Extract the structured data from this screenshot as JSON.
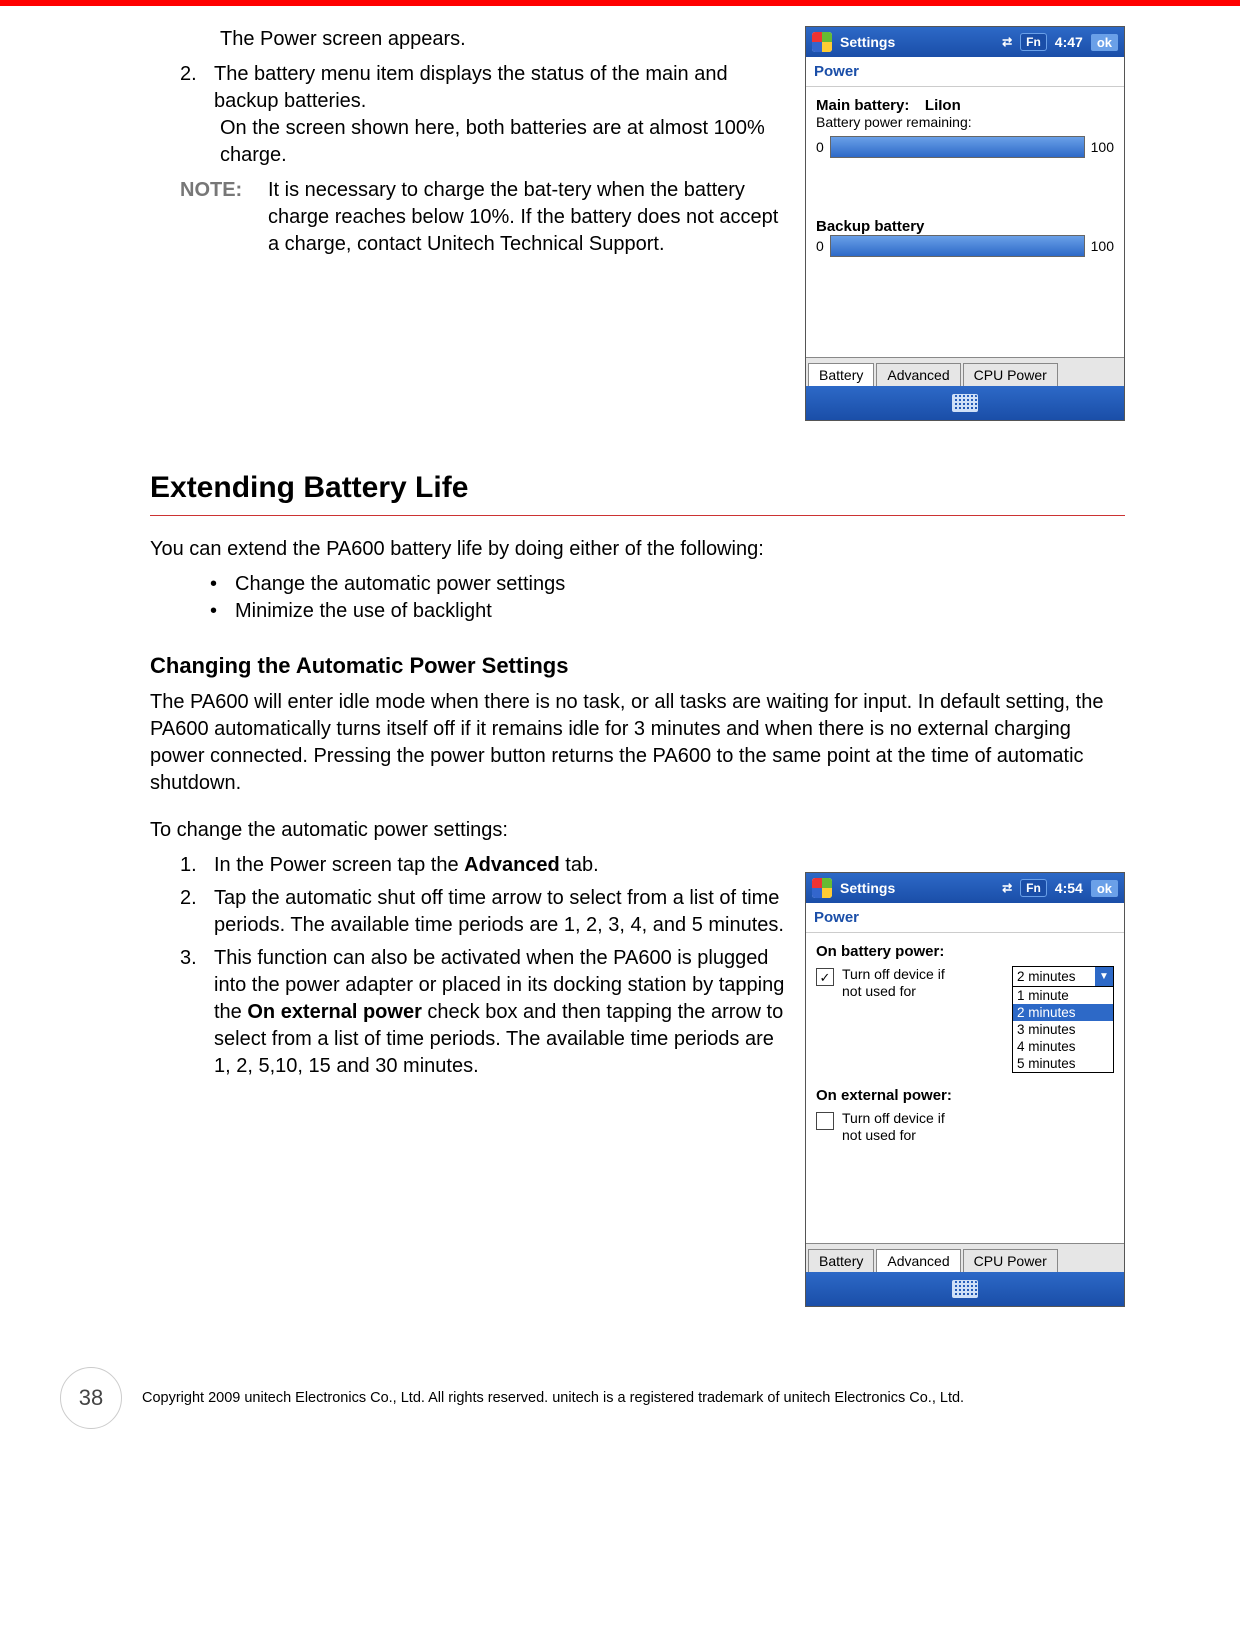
{
  "top": {
    "para1": "The Power screen appears.",
    "item2_num": "2.",
    "item2": "The battery menu item displays the status of the main and backup batteries.",
    "para2": "On the screen shown here, both batteries are at almost 100% charge.",
    "note_label": "NOTE:",
    "note_text": "It is necessary to charge the bat-tery when the battery charge reaches below 10%. If the battery does not accept a charge, contact Unitech Technical Support."
  },
  "device1": {
    "title": "Settings",
    "fn": "Fn",
    "time": "4:47",
    "ok": "ok",
    "sub": "Power",
    "main_label": "Main battery:",
    "main_type": "LiIon",
    "remaining": "Battery power remaining:",
    "min": "0",
    "max": "100",
    "backup_label": "Backup battery",
    "tabs": {
      "t1": "Battery",
      "t2": "Advanced",
      "t3": "CPU Power"
    }
  },
  "section": {
    "heading": "Extending Battery Life",
    "p1": "You can extend the PA600 battery life by doing either of the following:",
    "b1": "Change the automatic power settings",
    "b2": "Minimize the use of backlight",
    "sub": "Changing the Automatic Power Settings",
    "p2": "The PA600 will enter idle mode when there is no task, or all tasks are waiting for input. In default setting, the PA600 automatically turns itself off if it remains idle for 3 minutes and when there is no external charging power connected. Pressing the power button returns the PA600 to the same point at the time of automatic shutdown.",
    "p3": "To change the automatic power settings:",
    "i1n": "1.",
    "i1_pre": "In the Power screen tap the ",
    "i1_bold": "Advanced",
    "i1_post": " tab.",
    "i2n": "2.",
    "i2": "Tap the automatic shut off time arrow to select from a list of time periods. The available time periods are 1, 2, 3, 4, and 5 minutes.",
    "i3n": "3.",
    "i3_pre": "This function can also be activated when the PA600 is plugged into the power adapter or placed in its docking station by tapping the ",
    "i3_bold": "On external power",
    "i3_post": " check box and then tapping the arrow to select from a list of time periods. The available time periods are 1, 2, 5,10, 15 and 30 minutes."
  },
  "device2": {
    "title": "Settings",
    "fn": "Fn",
    "time": "4:54",
    "ok": "ok",
    "sub": "Power",
    "on_batt": "On battery power:",
    "turnoff": "Turn off device if not used for",
    "on_ext": "On external power:",
    "dd_selected": "2 minutes",
    "dd": {
      "o1": "1 minute",
      "o2": "2 minutes",
      "o3": "3 minutes",
      "o4": "4 minutes",
      "o5": "5 minutes"
    },
    "tabs": {
      "t1": "Battery",
      "t2": "Advanced",
      "t3": "CPU Power"
    }
  },
  "footer": {
    "page": "38",
    "copy": "Copyright 2009 unitech Electronics Co., Ltd. All rights reserved. unitech is a registered trademark of unitech Electronics Co., Ltd."
  }
}
